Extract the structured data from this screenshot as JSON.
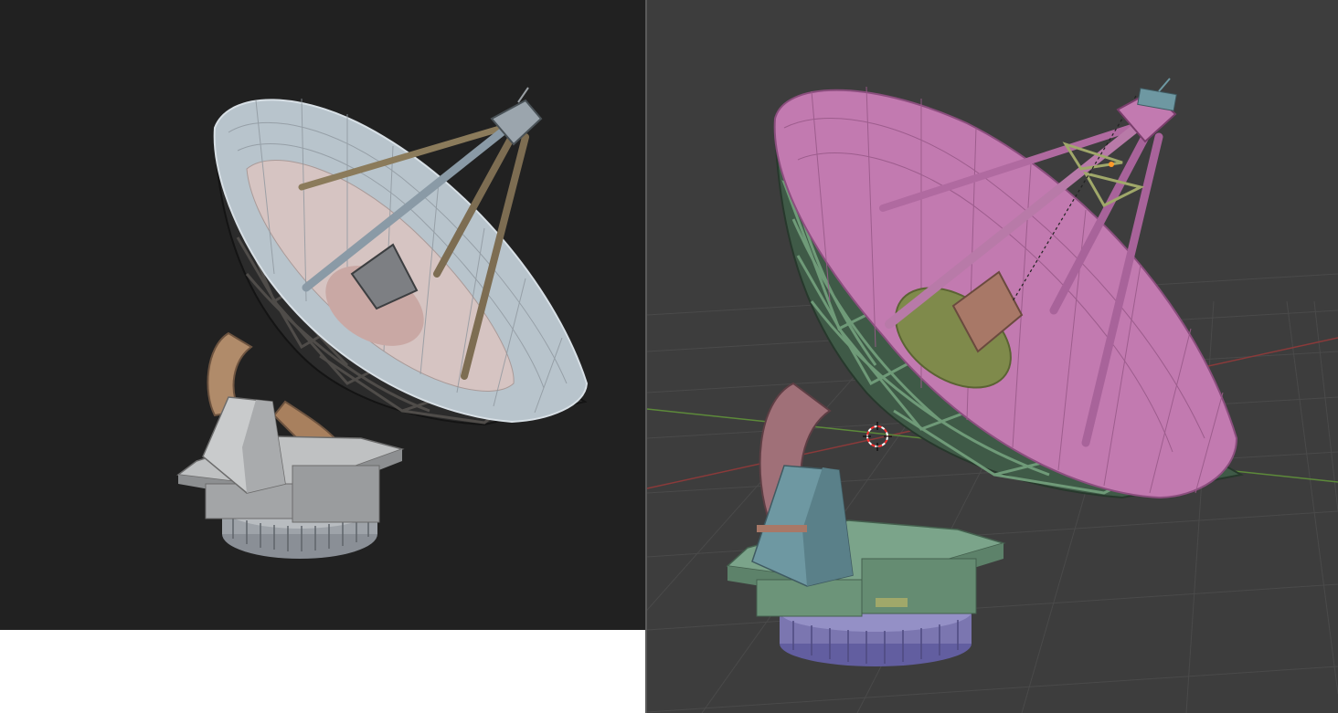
{
  "left_viewport": {
    "name": "textured-render-view",
    "background": "#212121",
    "model": "radio-telescope-textured"
  },
  "right_viewport": {
    "name": "solid-view-3d-viewport",
    "background": "#3d3d3d",
    "grid_color": "#4a4a4a",
    "x_axis_color": "#8a3a3a",
    "y_axis_color": "#5d8a3a",
    "cursor_color": "#ff3030",
    "model": "radio-telescope-colored-parts"
  },
  "colors": {
    "dish_textured": "#b8c4cc",
    "lattice_textured": "#2b2b2b",
    "base_textured": "#a9a9a9",
    "yoke_textured": "#b08b6a",
    "dish_viewport": "#c27ab0",
    "lattice_viewport": "#6f9a78",
    "mount_viewport": "#6e98a2",
    "platform_viewport": "#7ba48a",
    "ring_viewport": "#7b76b0",
    "hub_viewport": "#7f8a4b",
    "cone_viewport": "#a87867",
    "yoke_viewport": "#a07078"
  },
  "divider": {
    "color": "#5a5a5a"
  }
}
